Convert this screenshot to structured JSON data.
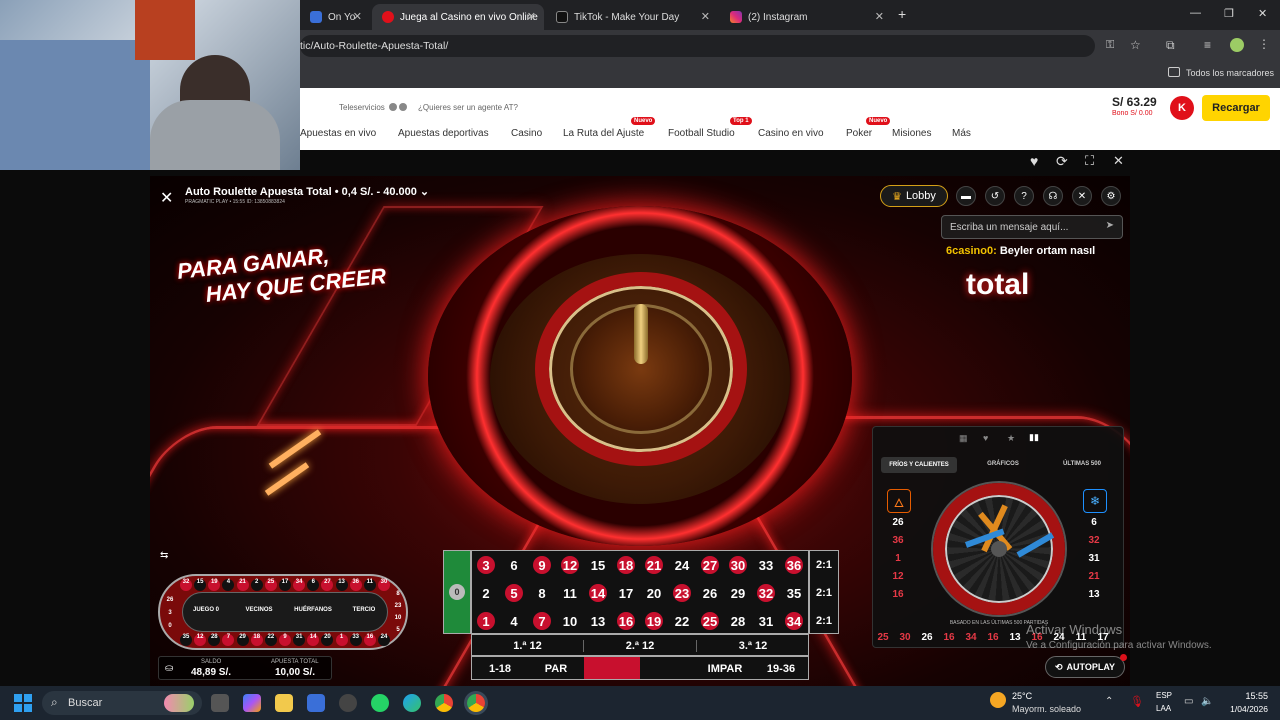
{
  "browser": {
    "tabs": [
      {
        "label": "On Yo",
        "active": false
      },
      {
        "label": "Juega al Casino en vivo Online",
        "active": true
      },
      {
        "label": "TikTok - Make Your Day",
        "active": false
      },
      {
        "label": "(2) Instagram",
        "active": false
      }
    ],
    "new_tab": "+",
    "url": "tic/Auto-Roulette-Apuesta-Total/",
    "bookmarks_label": "Todos los marcadores",
    "window_controls": [
      "—",
      "❐",
      "✕"
    ]
  },
  "site": {
    "teleservicios": "Teleservicios",
    "agent_question": "¿Quieres ser un agente AT?",
    "balance": "S/ 63.29",
    "bonus": "Bono S/ 0.00",
    "avatar_letter": "K",
    "recharge": "Recargar",
    "nav": [
      {
        "label": "Apuestas en vivo",
        "badge": ""
      },
      {
        "label": "Apuestas deportivas",
        "badge": ""
      },
      {
        "label": "Casino",
        "badge": ""
      },
      {
        "label": "La Ruta del Ajuste",
        "badge": "Nuevo"
      },
      {
        "label": "Football Studio",
        "badge": "Top 1"
      },
      {
        "label": "Casino en vivo",
        "badge": ""
      },
      {
        "label": "Poker",
        "badge": "Nuevo"
      },
      {
        "label": "Misiones",
        "badge": ""
      },
      {
        "label": "Más",
        "badge": ""
      }
    ]
  },
  "game": {
    "title": "Auto Roulette Apuesta Total",
    "limits": "0,4 S/. - 40.000",
    "provider": "PRAGMATIC PLAY",
    "provider_id": "• 15:55  ID: 13850883824",
    "slogan_line1": "PARA GANAR,",
    "slogan_line2": "HAY QUE CREER",
    "lobby": "Lobby",
    "chat_placeholder": "Escriba un mensaje aquí...",
    "chat_user": "6casino0:",
    "chat_message": "Beyler ortam nasıl",
    "brand_text": "total",
    "racetrack": {
      "labels": [
        "JUEGO 0",
        "VECINOS",
        "HUÉRFANOS",
        "TERCIO"
      ],
      "top_numbers": [
        "32",
        "15",
        "19",
        "4",
        "21",
        "2",
        "25",
        "17",
        "34",
        "6",
        "27",
        "13",
        "36",
        "11",
        "30"
      ],
      "bottom_numbers": [
        "35",
        "12",
        "28",
        "7",
        "29",
        "18",
        "22",
        "9",
        "31",
        "14",
        "20",
        "1",
        "33",
        "16",
        "24"
      ],
      "left_numbers": [
        "26",
        "3",
        "0"
      ],
      "right_numbers": [
        "8",
        "23",
        "10",
        "5"
      ]
    },
    "balance_label": "SALDO",
    "balance_value": "48,89 S/.",
    "bet_label": "APUESTA TOTAL",
    "bet_value": "10,00 S/.",
    "table": {
      "zero": "0",
      "rows": [
        [
          "3",
          "6",
          "9",
          "12",
          "15",
          "18",
          "21",
          "24",
          "27",
          "30",
          "33",
          "36"
        ],
        [
          "2",
          "5",
          "8",
          "11",
          "14",
          "17",
          "20",
          "23",
          "26",
          "29",
          "32",
          "35"
        ],
        [
          "1",
          "4",
          "7",
          "10",
          "13",
          "16",
          "19",
          "22",
          "25",
          "28",
          "31",
          "34"
        ]
      ],
      "column_bets": [
        "2:1",
        "2:1",
        "2:1"
      ],
      "dozens": [
        "1.ª 12",
        "2.ª 12",
        "3.ª 12"
      ],
      "outside": [
        "1-18",
        "PAR",
        "",
        "",
        "IMPAR",
        "19-36"
      ]
    },
    "stats": {
      "tabs": [
        "FRÍOS Y CALIENTES",
        "GRÁFICOS",
        "ÚLTIMAS 500"
      ],
      "hot_numbers": [
        "26",
        "36",
        "1",
        "12",
        "16"
      ],
      "cold_numbers": [
        "6",
        "32",
        "31",
        "21",
        "13"
      ],
      "caption": "BASADO EN LAS ÚLTIMAS 500 PARTIDAS"
    },
    "history": [
      "25",
      "30",
      "26",
      "16",
      "34",
      "16",
      "13",
      "16",
      "24",
      "11",
      "17"
    ],
    "autoplay": "AUTOPLAY"
  },
  "windows": {
    "activate_title": "Activar Windows",
    "activate_sub": "Ve a Configuración para activar Windows."
  },
  "taskbar": {
    "search": "Buscar",
    "weather_temp": "25°C",
    "weather_desc": "Mayorm. soleado",
    "lang1": "ESP",
    "lang2": "LAA",
    "time": "15:55",
    "date": "1/04/2026"
  }
}
